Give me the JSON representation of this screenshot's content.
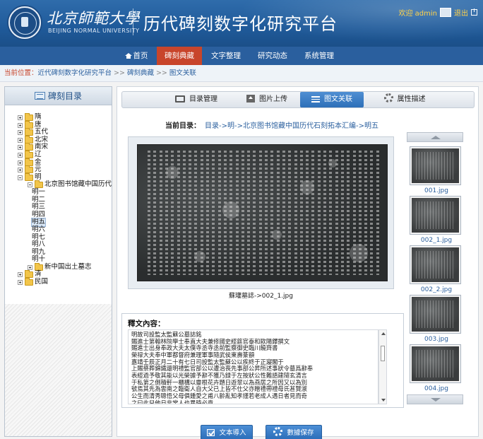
{
  "header": {
    "university_cn": "北京師範大學",
    "university_en": "BEIJING NORMAL UNIVERSITY",
    "system_title": "历代碑刻数字化研究平台",
    "welcome": "欢迎 admin",
    "logout": "退出"
  },
  "nav": {
    "items": [
      {
        "label": "首页"
      },
      {
        "label": "碑刻典藏"
      },
      {
        "label": "文字整理"
      },
      {
        "label": "研究动态"
      },
      {
        "label": "系统管理"
      }
    ],
    "active_index": 1
  },
  "breadcrumb": {
    "label": "当前位置：",
    "items": [
      "近代碑刻数字化研究平台",
      "碑刻典藏",
      "图文关联"
    ],
    "separator": ">>"
  },
  "sidebar": {
    "title": "碑刻目录",
    "tree": [
      {
        "label": "隋",
        "level": 0,
        "expander": "plus"
      },
      {
        "label": "唐",
        "level": 0,
        "expander": "plus"
      },
      {
        "label": "五代",
        "level": 0,
        "expander": "plus"
      },
      {
        "label": "北宋",
        "level": 0,
        "expander": "plus"
      },
      {
        "label": "南宋",
        "level": 0,
        "expander": "plus"
      },
      {
        "label": "辽",
        "level": 0,
        "expander": "plus"
      },
      {
        "label": "金",
        "level": 0,
        "expander": "plus"
      },
      {
        "label": "元",
        "level": 0,
        "expander": "plus"
      },
      {
        "label": "明",
        "level": 0,
        "expander": "minus"
      },
      {
        "label": "北京图书馆藏中国历代石",
        "level": 1,
        "expander": "minus"
      },
      {
        "label": "明一",
        "level": 2
      },
      {
        "label": "明二",
        "level": 2
      },
      {
        "label": "明三",
        "level": 2
      },
      {
        "label": "明四",
        "level": 2
      },
      {
        "label": "明五",
        "level": 2,
        "selected": true
      },
      {
        "label": "明六",
        "level": 2
      },
      {
        "label": "明七",
        "level": 2
      },
      {
        "label": "明八",
        "level": 2
      },
      {
        "label": "明九",
        "level": 2
      },
      {
        "label": "明十",
        "level": 2
      },
      {
        "label": "新中国出土墓志",
        "level": 1,
        "expander": "plus"
      },
      {
        "label": "清",
        "level": 0,
        "expander": "plus"
      },
      {
        "label": "民国",
        "level": 0,
        "expander": "plus"
      }
    ]
  },
  "tabs": [
    {
      "label": "目录管理",
      "icon": "monitor-icon"
    },
    {
      "label": "图片上传",
      "icon": "upload-icon"
    },
    {
      "label": "图文关联",
      "icon": "list-icon"
    },
    {
      "label": "属性描述",
      "icon": "gear-icon"
    }
  ],
  "active_tab": 2,
  "current_dir": {
    "label": "当前目录：",
    "path": "目录->明->北京图书馆藏中国历代石刻拓本汇编->明五"
  },
  "viewer": {
    "caption": "蘇瓘墓誌->002_1.jpg"
  },
  "thumbnails": [
    {
      "label": "001.jpg"
    },
    {
      "label": "002_1.jpg"
    },
    {
      "label": "002_2.jpg"
    },
    {
      "label": "003.jpg"
    },
    {
      "label": "004.jpg"
    }
  ],
  "transcription": {
    "title": "釋文內容：",
    "lines": [
      "明故司設監太監蘇公墓誌銘",
      "賜進士第翰林院學士奉直大夫兼修國史經筵官泰和歐陽鐸撰文",
      "賜進士出身奉政大夫太僕寺丞寺丞前監察御史臨川饒齊書",
      "榮禄大夫奉中軍都督府兼理軍事隨武侯東壽篆額",
      "嘉靖壬辰正月二十有七日司設監太監蘇公以疾終于正寢閣于",
      "上賜祭葬錦鐵還明禮監官部公以遭治喪先事部公昇所述事狀令墓爲辭奉",
      "表經過予敬其能以光榮據予辭不獲乃録于左按狀公性難語建隨玄清言",
      "于私第之側積軒一櫃構以靈根花卉題日遊翠以為燕居之所因又以為別",
      "號焉其先為雲南之臨衛人自大父已上皆不仕父亦贈禮帶禮母氏甚賢淑",
      "公生而清秀聰悟父母俱鍾愛之甫八齡亂知孝謹若老成人遇日者見而奇",
      "之曰此兒他日非常人也異時必貴"
    ]
  },
  "buttons": {
    "import": "文本導入",
    "save": "數據保存"
  }
}
